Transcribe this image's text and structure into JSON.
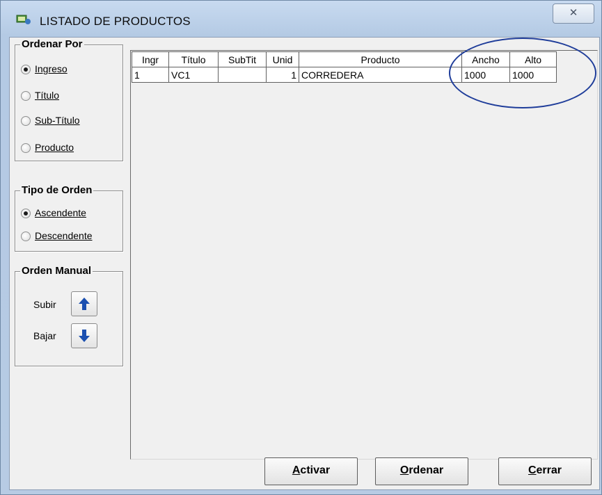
{
  "window": {
    "title": "LISTADO DE PRODUCTOS",
    "close_glyph": "✕"
  },
  "sort_by": {
    "title": "Ordenar Por",
    "options": [
      {
        "label": "Ingreso",
        "selected": true
      },
      {
        "label": "Título",
        "selected": false
      },
      {
        "label": "Sub-Título",
        "selected": false
      },
      {
        "label": "Producto",
        "selected": false
      }
    ]
  },
  "order_type": {
    "title": "Tipo de Orden",
    "options": [
      {
        "label": "Ascendente",
        "selected": true
      },
      {
        "label": "Descendente",
        "selected": false
      }
    ]
  },
  "manual_order": {
    "title": "Orden Manual",
    "up_label": "Subir",
    "down_label": "Bajar",
    "up_icon": "arrow-up-icon",
    "down_icon": "arrow-down-icon"
  },
  "table": {
    "columns": [
      "Ingr",
      "Título",
      "SubTit",
      "Unid",
      "Producto",
      "Ancho",
      "Alto"
    ],
    "rows": [
      [
        "1",
        "VC1",
        "",
        "1",
        "CORREDERA",
        "1000",
        "1000"
      ]
    ]
  },
  "buttons": {
    "activate": "ctivar",
    "activate_key": "A",
    "order": "rdenar",
    "order_key": "O",
    "close": "errar",
    "close_key": "C"
  },
  "annotation_color": "#1f3d9a"
}
